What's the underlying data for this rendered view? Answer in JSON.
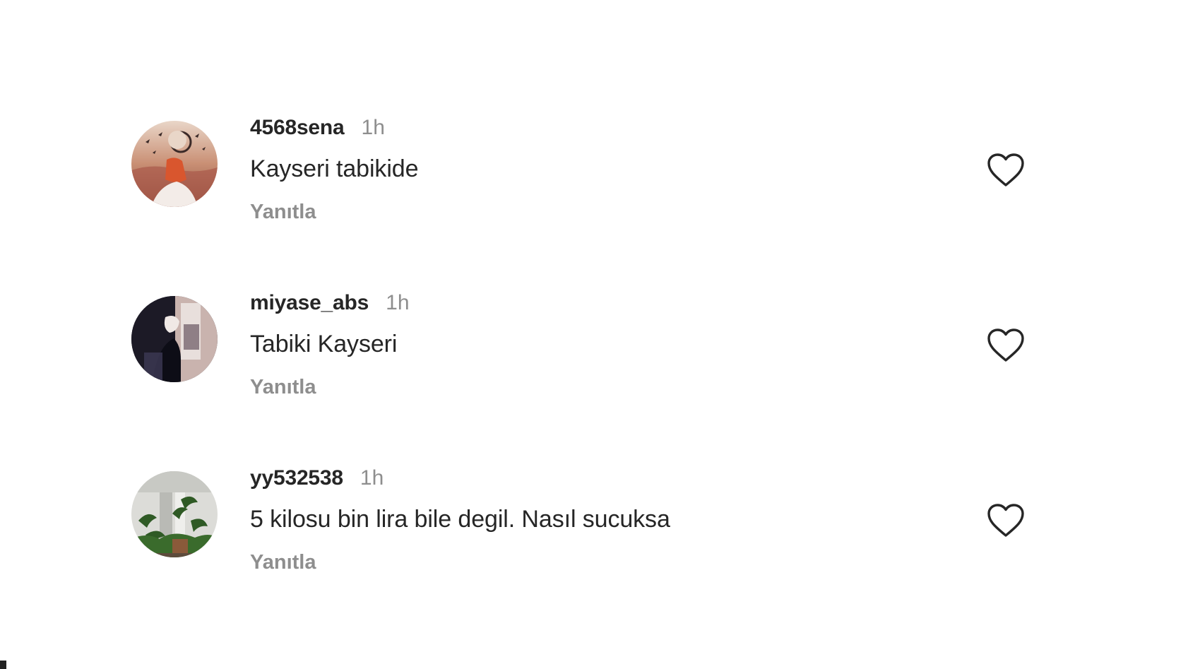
{
  "comments": [
    {
      "username": "4568sena",
      "time": "1h",
      "text": "Kayseri tabikide",
      "reply_label": "Yanıtla",
      "like_icon": "heart-outline-icon"
    },
    {
      "username": "miyase_abs",
      "time": "1h",
      "text": "Tabiki Kayseri",
      "reply_label": "Yanıtla",
      "like_icon": "heart-outline-icon"
    },
    {
      "username": "yy532538",
      "time": "1h",
      "text": "5 kilosu bin lira bile degil. Nasıl sucuksa",
      "reply_label": "Yanıtla",
      "like_icon": "heart-outline-icon"
    }
  ],
  "colors": {
    "primary_text": "#262626",
    "secondary_text": "#8e8e8e",
    "icon_stroke": "#262626",
    "background": "#ffffff"
  }
}
